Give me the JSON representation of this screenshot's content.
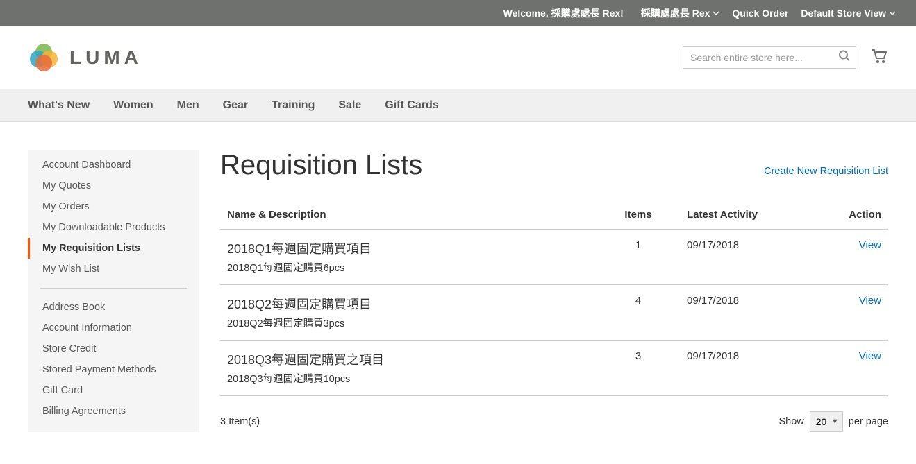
{
  "panel": {
    "welcome": "Welcome, 採購處處長 Rex!",
    "account_menu": "採購處處長 Rex",
    "quick_order": "Quick Order",
    "store_view": "Default Store View"
  },
  "header": {
    "logo_text": "LUMA",
    "search_placeholder": "Search entire store here..."
  },
  "nav": {
    "items": [
      "What's New",
      "Women",
      "Men",
      "Gear",
      "Training",
      "Sale",
      "Gift Cards"
    ]
  },
  "sidebar": {
    "items": [
      {
        "label": "Account Dashboard",
        "current": false
      },
      {
        "label": "My Quotes",
        "current": false
      },
      {
        "label": "My Orders",
        "current": false
      },
      {
        "label": "My Downloadable Products",
        "current": false
      },
      {
        "label": "My Requisition Lists",
        "current": true
      },
      {
        "label": "My Wish List",
        "current": false
      }
    ],
    "items2": [
      {
        "label": "Address Book"
      },
      {
        "label": "Account Information"
      },
      {
        "label": "Store Credit"
      },
      {
        "label": "Stored Payment Methods"
      },
      {
        "label": "Gift Card"
      },
      {
        "label": "Billing Agreements"
      }
    ]
  },
  "main": {
    "title": "Requisition Lists",
    "create_label": "Create New Requisition List",
    "columns": {
      "name": "Name & Description",
      "items": "Items",
      "latest": "Latest Activity",
      "action": "Action"
    },
    "rows": [
      {
        "name": "2018Q1每週固定購買項目",
        "desc": "2018Q1每週固定購買6pcs",
        "items": "1",
        "latest": "09/17/2018",
        "action": "View"
      },
      {
        "name": "2018Q2每週固定購買項目",
        "desc": "2018Q2每週固定購買3pcs",
        "items": "4",
        "latest": "09/17/2018",
        "action": "View"
      },
      {
        "name": "2018Q3每週固定購買之項目",
        "desc": "2018Q3每週固定購買10pcs",
        "items": "3",
        "latest": "09/17/2018",
        "action": "View"
      }
    ],
    "count_text": "3 Item(s)",
    "show_label": "Show",
    "per_page_label": "per page",
    "limiter_options": [
      "20"
    ],
    "limiter_selected": "20"
  }
}
